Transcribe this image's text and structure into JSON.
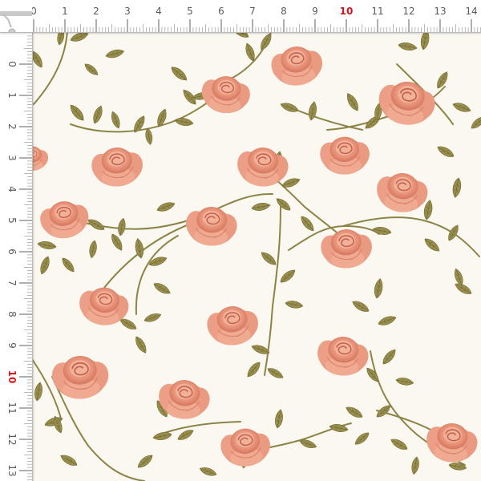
{
  "ruler": {
    "unit": "cm",
    "top_labels": [
      "0",
      "1",
      "2",
      "3",
      "4",
      "5",
      "6",
      "7",
      "8",
      "9",
      "10",
      "11",
      "12",
      "13",
      "14"
    ],
    "left_labels": [
      "0",
      "1",
      "2",
      "3",
      "4",
      "5",
      "6",
      "7",
      "8",
      "9",
      "10",
      "11",
      "12",
      "13"
    ],
    "highlight_label": "10",
    "label_color": "#5a5a5a",
    "highlight_color": "#d4141c"
  },
  "pattern": {
    "motif": "rose-vine",
    "background_color": "#fbf8f1",
    "rose_color": "#e8937a",
    "rose_shadow_color": "#c8664f",
    "leaf_color": "#9a8f4e",
    "leaf_vein_color": "#6f6a33",
    "stem_color": "#8c8447"
  }
}
